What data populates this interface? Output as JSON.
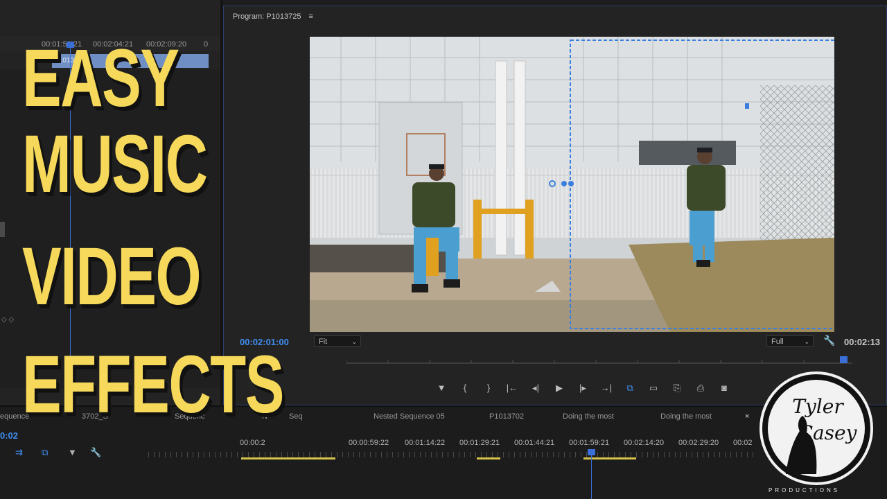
{
  "title_overlay": {
    "line1": "EASY",
    "line2": "MUSIC",
    "line3": "VIDEO",
    "line4": "EFFECTS"
  },
  "source_panel": {
    "timecodes": [
      "00:01:59:21",
      "00:02:04:21",
      "00:02:09:20",
      "0"
    ],
    "clip_label": "P1013724",
    "keyframe_glyph": "◇ ◇"
  },
  "program_monitor": {
    "title": "Program: P1013725",
    "menu_glyph": "≡",
    "timecode_current": "00:02:01:00",
    "timecode_duration": "00:02:13",
    "fit_label": "Fit",
    "quality_label": "Full",
    "transport": [
      "▼",
      "{",
      "}",
      "|←",
      "◂|",
      "▶",
      "|▸",
      "→|",
      "⧉",
      "▭",
      "⎘",
      "⎙",
      "◙"
    ]
  },
  "bottom_tabs": {
    "items": [
      "equence",
      "3702_S",
      "Sequenc",
      "N",
      "Seq",
      "Nested Sequence 05",
      "P1013702",
      "Doing the most",
      "Doing the most"
    ],
    "close": "×"
  },
  "timeline": {
    "current_timecode": "0:02",
    "ruler_timecodes": [
      "00:00:2",
      "00:00:59:22",
      "00:01:14:22",
      "00:01:29:21",
      "00:01:44:21",
      "00:01:59:21",
      "00:02:14:20",
      "00:02:29:20",
      "00:02"
    ]
  },
  "logo": {
    "name_line1": "Tyler",
    "name_line2": "Casey",
    "subtitle": "PRODUCTIONS"
  },
  "colors": {
    "accent_blue": "#3f8ef0",
    "title_yellow": "#f6d95a",
    "selection_blue": "#3a7fe0",
    "clip_yellow": "#d6c34a"
  }
}
